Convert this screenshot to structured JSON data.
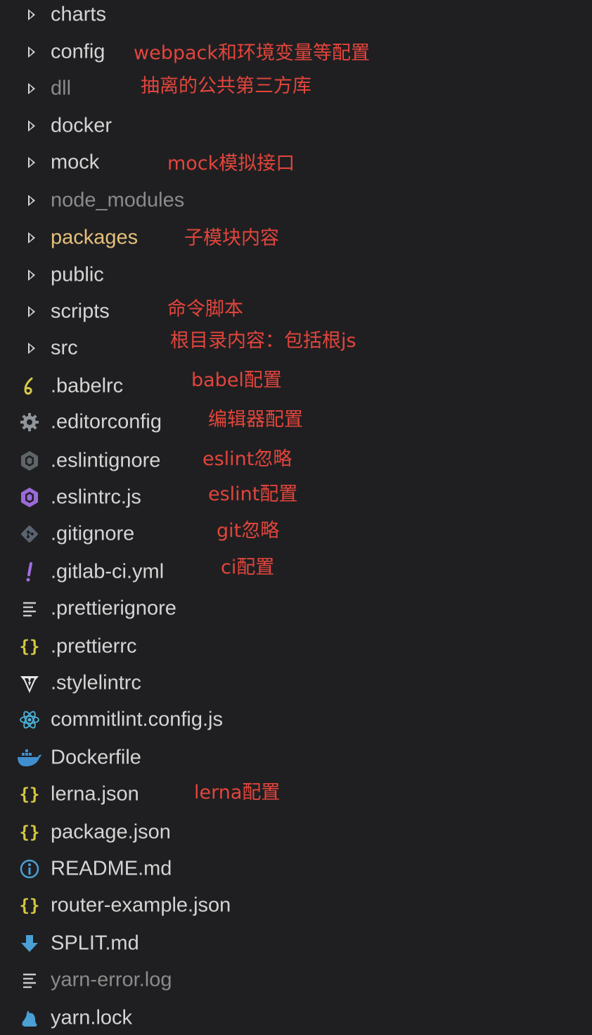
{
  "colors": {
    "background": "#1f1f21",
    "text": "#d4d4d4",
    "dim_text": "#8b8b8b",
    "highlight_text": "#e5c07b",
    "annotation": "#e2453c"
  },
  "folders": [
    {
      "name": "charts",
      "style": "normal",
      "note": ""
    },
    {
      "name": "config",
      "style": "normal",
      "note": "webpack和环境变量等配置"
    },
    {
      "name": "dll",
      "style": "dim",
      "note": "抽离的公共第三方库"
    },
    {
      "name": "docker",
      "style": "normal",
      "note": ""
    },
    {
      "name": "mock",
      "style": "normal",
      "note": "mock模拟接口"
    },
    {
      "name": "node_modules",
      "style": "dim",
      "note": ""
    },
    {
      "name": "packages",
      "style": "yellow",
      "note": "子模块内容"
    },
    {
      "name": "public",
      "style": "normal",
      "note": ""
    },
    {
      "name": "scripts",
      "style": "normal",
      "note": "命令脚本"
    },
    {
      "name": "src",
      "style": "normal",
      "note": "根目录内容：包括根js"
    }
  ],
  "files": [
    {
      "name": ".babelrc",
      "icon": "babel-icon",
      "style": "normal",
      "note": "babel配置"
    },
    {
      "name": ".editorconfig",
      "icon": "gear-icon",
      "style": "normal",
      "note": "编辑器配置"
    },
    {
      "name": ".eslintignore",
      "icon": "eslint-gray-icon",
      "style": "normal",
      "note": "eslint忽略"
    },
    {
      "name": ".eslintrc.js",
      "icon": "eslint-purple-icon",
      "style": "normal",
      "note": "eslint配置"
    },
    {
      "name": ".gitignore",
      "icon": "git-icon",
      "style": "normal",
      "note": "git忽略"
    },
    {
      "name": ".gitlab-ci.yml",
      "icon": "yaml-exclamation-icon",
      "style": "normal",
      "note": "ci配置"
    },
    {
      "name": ".prettierignore",
      "icon": "lines-icon",
      "style": "normal",
      "note": ""
    },
    {
      "name": ".prettierrc",
      "icon": "json-braces-icon",
      "style": "normal",
      "note": ""
    },
    {
      "name": ".stylelintrc",
      "icon": "stylelint-icon",
      "style": "normal",
      "note": ""
    },
    {
      "name": "commitlint.config.js",
      "icon": "atom-icon",
      "style": "normal",
      "note": ""
    },
    {
      "name": "Dockerfile",
      "icon": "docker-whale-icon",
      "style": "normal",
      "note": ""
    },
    {
      "name": "lerna.json",
      "icon": "json-braces-icon",
      "style": "normal",
      "note": "lerna配置"
    },
    {
      "name": "package.json",
      "icon": "json-braces-icon",
      "style": "normal",
      "note": ""
    },
    {
      "name": "README.md",
      "icon": "info-icon",
      "style": "normal",
      "note": ""
    },
    {
      "name": "router-example.json",
      "icon": "json-braces-icon",
      "style": "normal",
      "note": ""
    },
    {
      "name": "SPLIT.md",
      "icon": "markdown-arrow-icon",
      "style": "normal",
      "note": ""
    },
    {
      "name": "yarn-error.log",
      "icon": "lines-icon",
      "style": "dim",
      "note": ""
    },
    {
      "name": "yarn.lock",
      "icon": "yarn-cat-icon",
      "style": "normal",
      "note": ""
    }
  ]
}
